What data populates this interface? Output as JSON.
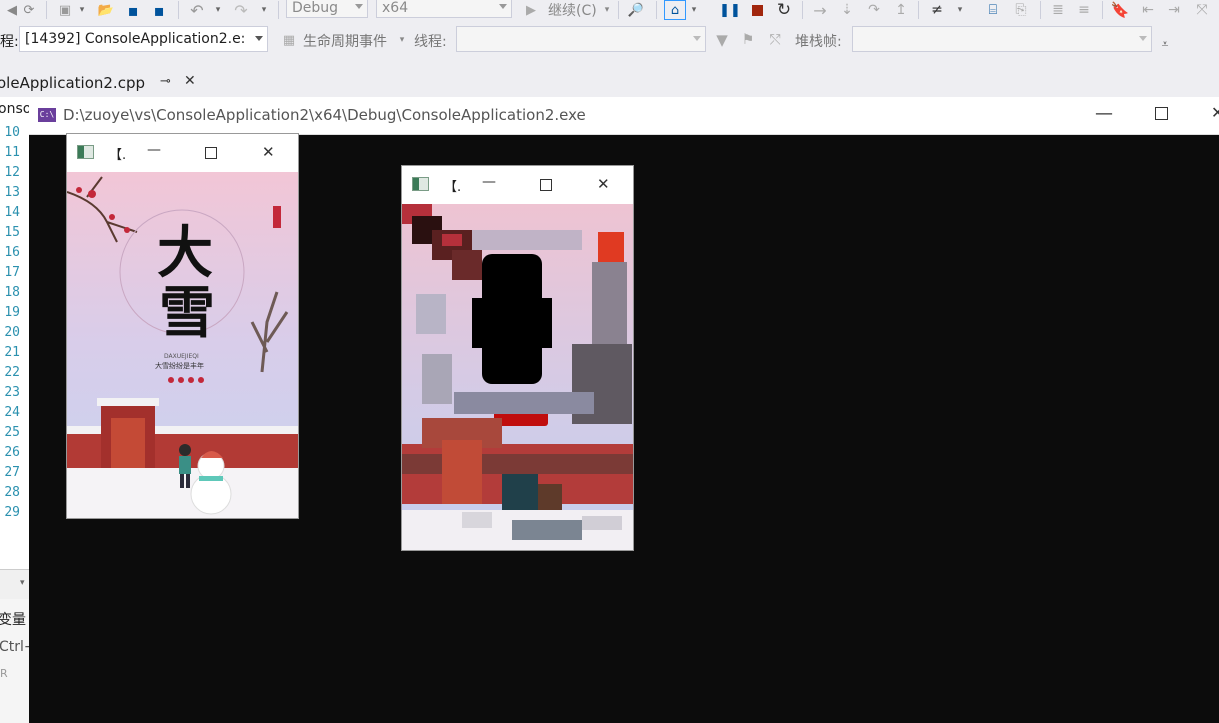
{
  "toolbar": {
    "config_value": "Debug",
    "platform_value": "x64",
    "continue_label": "继续(C)"
  },
  "debug_bar": {
    "process_prefix": "程:",
    "process_value": "[14392] ConsoleApplication2.e:",
    "lifecycle_label": "生命周期事件",
    "thread_label": "线程:",
    "thread_value": "",
    "stackframe_label": "堆栈帧:",
    "stackframe_value": ""
  },
  "document_tab": {
    "label": "oleApplication2.cpp",
    "pin_glyph": "⊸",
    "close_glyph": "✕"
  },
  "solution_label": "onso",
  "line_numbers": [
    "10",
    "11",
    "12",
    "13",
    "14",
    "15",
    "16",
    "17",
    "18",
    "19",
    "20",
    "21",
    "22",
    "23",
    "24",
    "25",
    "26",
    "27",
    "28",
    "29"
  ],
  "side_panel": {
    "vars_label": "变量",
    "ctrl_label": "Ctrl+",
    "r_label": "R"
  },
  "console": {
    "title": "D:\\zuoye\\vs\\ConsoleApplication2\\x64\\Debug\\ConsoleApplication2.exe",
    "icon_text": "C:\\"
  },
  "image_window_1": {
    "title": "【.",
    "poster_big1": "大",
    "poster_big2": "雪",
    "poster_pinyin": "DAXUEJIEQI",
    "poster_sub": "大雪纷纷是丰年"
  },
  "image_window_2": {
    "title": "【."
  },
  "colors": {
    "accent": "#007acc",
    "console_bg": "#0c0c0c",
    "line_number": "#2b91af"
  }
}
